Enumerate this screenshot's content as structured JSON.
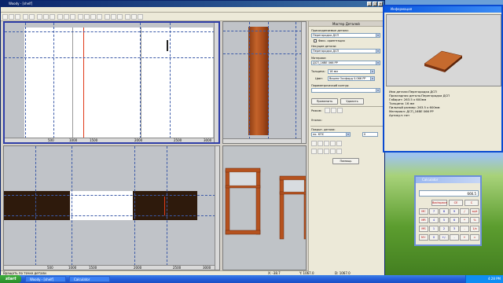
{
  "app": {
    "title": "Woody - [shelf]",
    "menu": [
      "Файл",
      "Правка",
      "Инструменты",
      "Вид",
      "Настройки",
      "Окна",
      "Помощь"
    ],
    "status": [
      "Вращать по точке детали",
      "Х: -38.7",
      "Y: 1067.0",
      "D: 1067.0"
    ]
  },
  "panel": {
    "title": "Мастер Деталей",
    "attach_label": "Присоединяемые детали:",
    "attach_value": "Перегородка ДСП",
    "fix_label": "Фикс. ориентация",
    "base_label": "Несущие детали:",
    "base_value": "Перегородка ДСП",
    "material_label": "Материал:",
    "material_value": "ДСП_16ВЕ 066 РР",
    "thickness_label": "Толщина:",
    "thickness_value": "16 мм",
    "color_label": "Цвет:",
    "color_value": "Вишня Оксфорд 0.066 РР",
    "contour_label": "Параметрический контур:",
    "apply_label": "Применить",
    "delete_label": "Удалить",
    "mode_label": "Режим:",
    "angle_label": "Уголок:",
    "edge_label": "Покрыт. детали:",
    "edge_value": "по. КПС",
    "edge_num": "0",
    "help_label": "Помощь"
  },
  "info": {
    "title": "Информация",
    "lines": [
      "Имя детали:Перегородка ДСП",
      "Прикладная деталь:Перегородка ДСП",
      "Габарит: 263.5 x 600мм",
      "Толщина: 16 мм",
      "Пильный размер: 263.5 x 600мм",
      "Материал: ДСП_16ВЕ 066 РР",
      "Артикул: нет"
    ]
  },
  "calc": {
    "title": "Calculator",
    "menu": [
      "Edit",
      "View",
      "Help"
    ],
    "display": "666.5",
    "keys_top": [
      "Backspace",
      "CE",
      "C"
    ],
    "keys": [
      [
        "MC",
        "7",
        "8",
        "9",
        "/",
        "sqrt"
      ],
      [
        "MR",
        "4",
        "5",
        "6",
        "*",
        "%"
      ],
      [
        "MS",
        "1",
        "2",
        "3",
        "-",
        "1/x"
      ],
      [
        "M+",
        "0",
        "+/-",
        ".",
        "+",
        "="
      ]
    ]
  },
  "taskbar": {
    "start": "start",
    "tasks": [
      "Woody - [shelf]",
      "Calculator"
    ],
    "clock": "4:28 PM"
  },
  "rulers": {
    "top_left": [
      "500",
      "1000",
      "1500",
      "2000",
      "2500",
      "3000"
    ],
    "bottom_left": [
      "500",
      "1000",
      "1500",
      "2000",
      "2500",
      "3000"
    ]
  },
  "colors": {
    "wood": "#b5521e",
    "wood_dark": "#3a1f0e",
    "xp_blue": "#245edb",
    "viewport_bg": "#c0c3c8"
  }
}
